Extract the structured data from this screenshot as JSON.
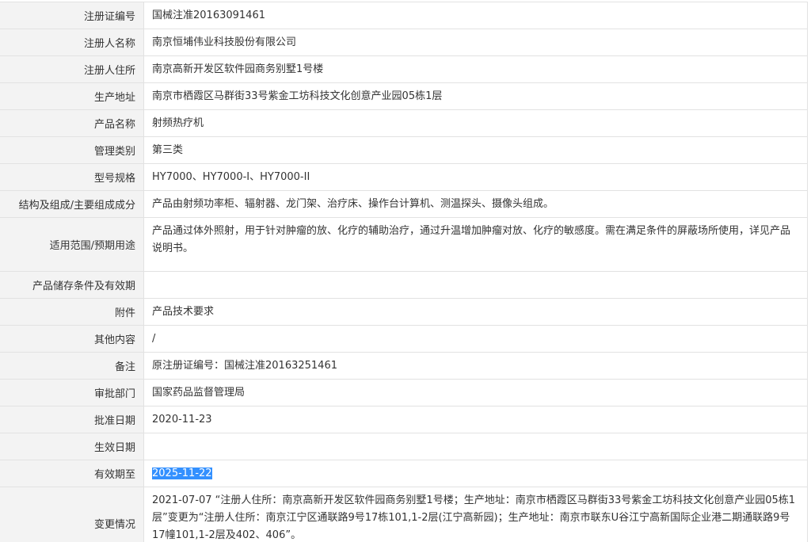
{
  "rows": [
    {
      "label": "注册证编号",
      "value": "国械注准20163091461"
    },
    {
      "label": "注册人名称",
      "value": "南京恒埔伟业科技股份有限公司"
    },
    {
      "label": "注册人住所",
      "value": "南京高新开发区软件园商务别墅1号楼"
    },
    {
      "label": "生产地址",
      "value": "南京市栖霞区马群街33号紫金工坊科技文化创意产业园05栋1层"
    },
    {
      "label": "产品名称",
      "value": "射频热疗机"
    },
    {
      "label": "管理类别",
      "value": "第三类"
    },
    {
      "label": "型号规格",
      "value": "HY7000、HY7000-I、HY7000-II"
    },
    {
      "label": "结构及组成/主要组成成分",
      "value": "产品由射频功率柜、辐射器、龙门架、治疗床、操作台计算机、测温探头、摄像头组成。"
    },
    {
      "label": "适用范围/预期用途",
      "value": "产品通过体外照射，用于针对肿瘤的放、化疗的辅助治疗，通过升温增加肿瘤对放、化疗的敏感度。需在满足条件的屏蔽场所使用，详见产品说明书。"
    },
    {
      "label": "产品储存条件及有效期",
      "value": ""
    },
    {
      "label": "附件",
      "value": "产品技术要求"
    },
    {
      "label": "其他内容",
      "value": "/"
    },
    {
      "label": "备注",
      "value": "原注册证编号：国械注准20163251461"
    },
    {
      "label": "审批部门",
      "value": "国家药品监督管理局"
    },
    {
      "label": "批准日期",
      "value": "2020-11-23"
    },
    {
      "label": "生效日期",
      "value": ""
    },
    {
      "label": "有效期至",
      "value": "2025-11-22"
    },
    {
      "label": "变更情况",
      "value": "2021-07-07 “注册人住所：南京高新开发区软件园商务别墅1号楼；生产地址：南京市栖霞区马群街33号紫金工坊科技文化创意产业园05栋1层”变更为“注册人住所：南京江宁区通联路9号17栋101,1-2层(江宁高新园)；生产地址：南京市联东U谷江宁高新国际企业港二期通联路9号17幢101,1-2层及402、406”。"
    }
  ],
  "colors": {
    "label_bg": "#f3f3f3",
    "border": "#e2e2e2",
    "selection": "#3390ff"
  }
}
